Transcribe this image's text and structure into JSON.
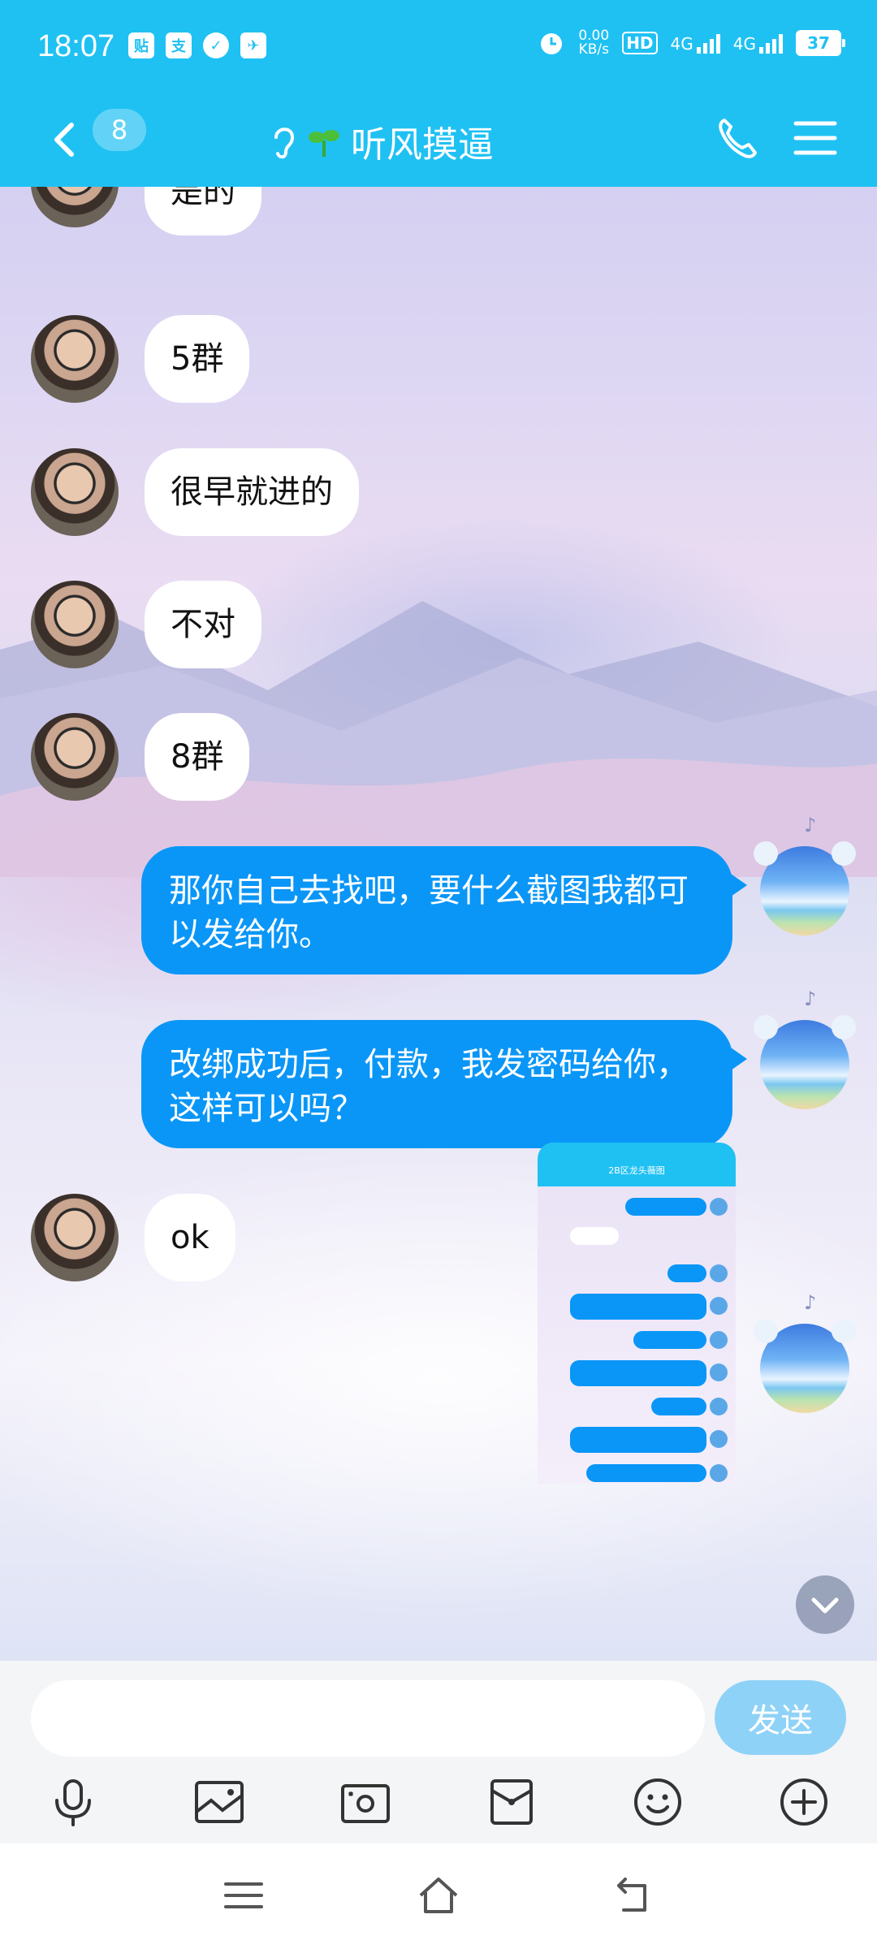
{
  "status_bar": {
    "time": "18:07",
    "app_icons": [
      "贴",
      "支",
      "✓",
      "✈"
    ],
    "net_speed": "0.00",
    "net_unit": "KB/s",
    "hd_label": "HD",
    "signal_labels": [
      "4G",
      "4G"
    ],
    "battery": "37"
  },
  "header": {
    "unread_count": "8",
    "title": "听风摸逼"
  },
  "messages": {
    "incoming_1": "是的",
    "incoming_2": "5群",
    "incoming_3": "很早就进的",
    "incoming_4": "不对",
    "incoming_5": "8群",
    "outgoing_1": "那你自己去找吧，要什么截图我都可以发给你。",
    "outgoing_2": "改绑成功后，付款，我发密码给你，这样可以吗？",
    "incoming_6": "ok"
  },
  "screenshot_preview": {
    "title": "2B区龙头薇图"
  },
  "composer": {
    "send_label": "发送"
  },
  "icons": {
    "back": "chevron-left-icon",
    "ear": "ear-icon",
    "sprout": "sprout-icon",
    "phone": "phone-icon",
    "menu": "menu-icon",
    "voice": "microphone-icon",
    "image": "image-icon",
    "camera": "camera-icon",
    "red_packet": "red-packet-icon",
    "emoji": "emoji-icon",
    "plus": "plus-icon"
  },
  "colors": {
    "accent": "#1fc1f3",
    "outgoing_bubble": "#0a96f7",
    "send_button": "#8fd2f7"
  }
}
